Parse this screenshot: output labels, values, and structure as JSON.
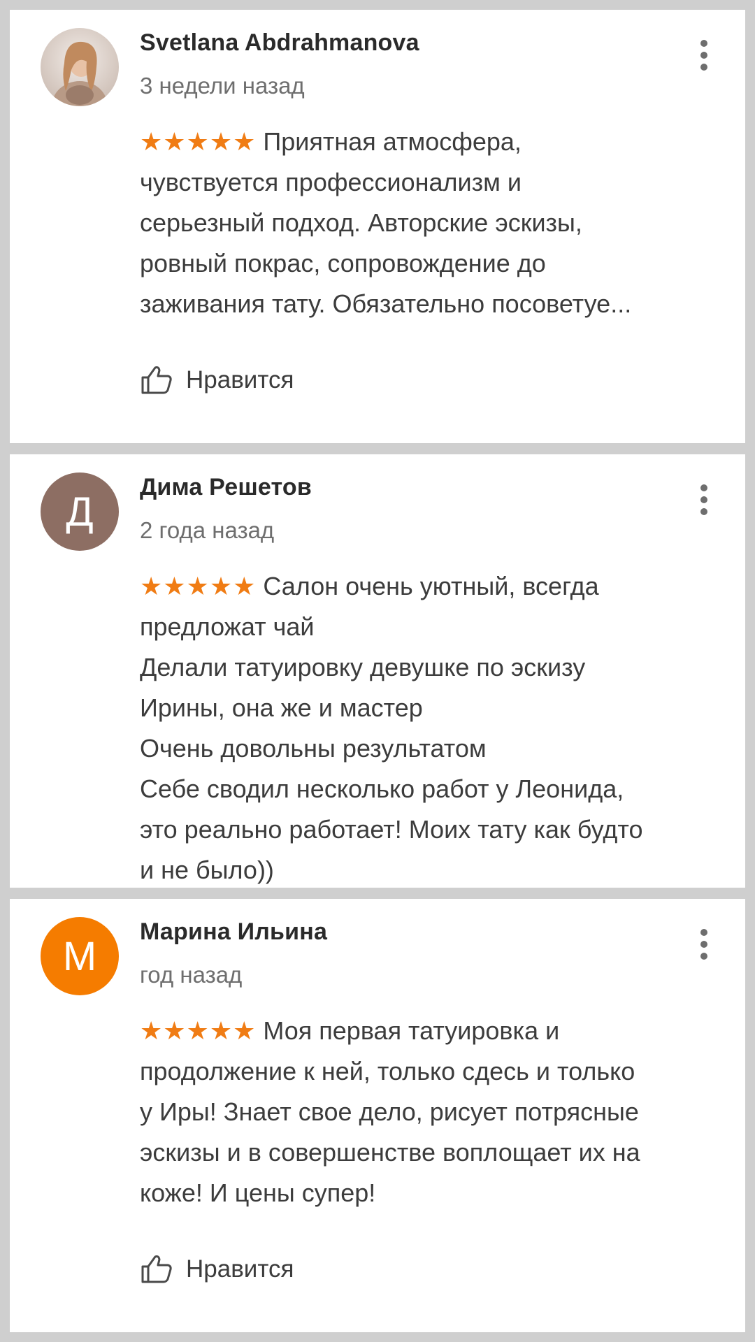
{
  "reviews": [
    {
      "author": "Svetlana Abdrahmanova",
      "date": "3 недели назад",
      "avatar_type": "photo",
      "stars": "★★★★★",
      "rating": 5,
      "text_lines": [
        "Приятная атмосфера,",
        "чувствуется профессионализм и",
        "серьезный подход. Авторские эскизы,",
        "ровный покрас, сопровождение до",
        "заживания тату.  Обязательно посоветуе..."
      ],
      "like_label": "Нравится"
    },
    {
      "author": "Дима Решетов",
      "date": "2 года назад",
      "avatar_letter": "Д",
      "avatar_color": "#8d6e63",
      "stars": "★★★★★",
      "rating": 5,
      "text_lines": [
        "Салон очень уютный, всегда",
        "предложат чай",
        "Делали татуировку девушке по эскизу",
        "Ирины, она же и мастер",
        "Очень довольны результатом",
        "Себе сводил несколько работ у Леонида,",
        "это реально работает! Моих тату как будто",
        "и не было))"
      ]
    },
    {
      "author": "Марина Ильина",
      "date": "год назад",
      "avatar_letter": "М",
      "avatar_color": "#f57c00",
      "stars": "★★★★★",
      "rating": 5,
      "text_lines": [
        "Моя первая татуировка и",
        "продолжение к ней, только сдесь и только",
        "у Иры! Знает свое дело, рисует потрясные",
        "эскизы и в совершенстве воплощает их на",
        "коже! И цены супер!"
      ],
      "like_label": "Нравится"
    }
  ],
  "colors": {
    "star": "#f07c14",
    "background": "#cfcfcf",
    "card": "#ffffff"
  },
  "icons": {
    "menu": "more-vertical-icon",
    "like": "thumbs-up-icon"
  }
}
